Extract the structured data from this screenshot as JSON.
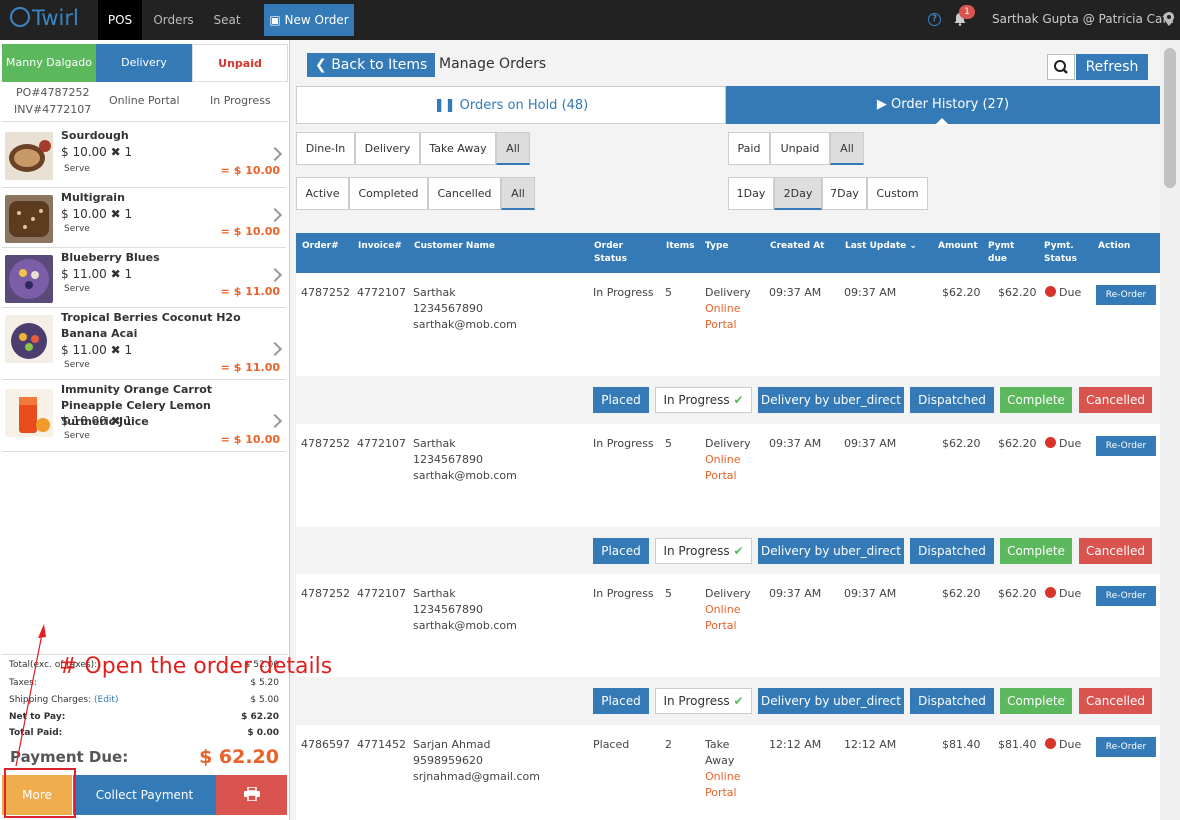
{
  "header": {
    "logo": "Twirl",
    "nav": [
      "POS",
      "Orders",
      "Seat"
    ],
    "new_order": "New Order",
    "notif_count": "1",
    "user": "Sarthak Gupta @ Patricia Cafe"
  },
  "left": {
    "tabs": [
      "Manny Dalgado",
      "Delivery",
      "Unpaid"
    ],
    "po": "PO#4787252",
    "inv": "INV#4772107",
    "source": "Online Portal",
    "status": "In Progress",
    "items": [
      {
        "name": "Sourdough",
        "price": "$ 10.00",
        "qty": "1",
        "serve": "Serve",
        "total": "= $ 10.00"
      },
      {
        "name": "Multigrain",
        "price": "$ 10.00",
        "qty": "1",
        "serve": "Serve",
        "total": "= $ 10.00"
      },
      {
        "name": "Blueberry Blues",
        "price": "$ 11.00",
        "qty": "1",
        "serve": "Serve",
        "total": "= $ 11.00"
      },
      {
        "name": "Tropical Berries Coconut H2o Banana Acai",
        "price": "$ 11.00",
        "qty": "1",
        "serve": "Serve",
        "total": "= $ 11.00"
      },
      {
        "name": "Immunity Orange Carrot Pineapple Celery Lemon Turmeric Juice",
        "price": "$ 10.00",
        "qty": "1",
        "serve": "Serve",
        "total": "= $ 10.00"
      }
    ],
    "totals": {
      "subtotal_label": "Total(exc. of taxes):",
      "subtotal": "$ 52.00",
      "taxes_label": "Taxes:",
      "taxes": "$ 5.20",
      "shipping_label": "Shipping Charges:",
      "shipping_edit": "(Edit)",
      "shipping": "$ 5.00",
      "net_label": "Net to Pay:",
      "net": "$ 62.20",
      "paid_label": "Total Paid:",
      "paid": "$ 0.00"
    },
    "payment_due_label": "Payment Due:",
    "payment_due": "$ 62.20",
    "more": "More",
    "collect": "Collect Payment"
  },
  "main": {
    "back": "Back to Items",
    "title": "Manage Orders",
    "refresh": "Refresh",
    "tab_hold": "Orders on Hold (48)",
    "tab_history": "Order History (27)",
    "filter_type": [
      "Dine-In",
      "Delivery",
      "Take Away",
      "All"
    ],
    "filter_pay": [
      "Paid",
      "Unpaid",
      "All"
    ],
    "filter_state": [
      "Active",
      "Completed",
      "Cancelled",
      "All"
    ],
    "filter_period": [
      "1Day",
      "2Day",
      "7Day",
      "Custom"
    ],
    "columns": [
      "Order#",
      "Invoice#",
      "Customer Name",
      "Order Status",
      "Items",
      "Type",
      "Created At",
      "Last Update",
      "Amount",
      "Pymt due",
      "Pymt. Status",
      "Action"
    ],
    "orders": [
      {
        "order": "4787252",
        "invoice": "4772107",
        "name": "Sarthak",
        "phone": "1234567890",
        "email": "sarthak@mob.com",
        "status": "In Progress",
        "items": "5",
        "type1": "Delivery",
        "type2": "Online",
        "type3": "Portal",
        "created": "09:37 AM",
        "updated": "09:37 AM",
        "amount": "$62.20",
        "due": "$62.20",
        "pstatus": "Due",
        "action": "Re-Order"
      },
      {
        "order": "4787252",
        "invoice": "4772107",
        "name": "Sarthak",
        "phone": "1234567890",
        "email": "sarthak@mob.com",
        "status": "In Progress",
        "items": "5",
        "type1": "Delivery",
        "type2": "Online",
        "type3": "Portal",
        "created": "09:37 AM",
        "updated": "09:37 AM",
        "amount": "$62.20",
        "due": "$62.20",
        "pstatus": "Due",
        "action": "Re-Order"
      },
      {
        "order": "4787252",
        "invoice": "4772107",
        "name": "Sarthak",
        "phone": "1234567890",
        "email": "sarthak@mob.com",
        "status": "In Progress",
        "items": "5",
        "type1": "Delivery",
        "type2": "Online",
        "type3": "Portal",
        "created": "09:37 AM",
        "updated": "09:37 AM",
        "amount": "$62.20",
        "due": "$62.20",
        "pstatus": "Due",
        "action": "Re-Order"
      },
      {
        "order": "4786597",
        "invoice": "4771452",
        "name": "Sarjan Ahmad",
        "phone": "9598959620",
        "email": "srjnahmad@gmail.com",
        "status": "Placed",
        "items": "2",
        "type1": "Take",
        "type1b": "Away",
        "type2": "Online",
        "type3": "Portal",
        "created": "12:12 AM",
        "updated": "12:12 AM",
        "amount": "$81.40",
        "due": "$81.40",
        "pstatus": "Due",
        "action": "Re-Order"
      }
    ],
    "status_buttons": [
      "Placed",
      "In Progress",
      "Delivery by uber_direct",
      "Dispatched",
      "Complete",
      "Cancelled"
    ]
  },
  "annotation": "# Open the order details"
}
